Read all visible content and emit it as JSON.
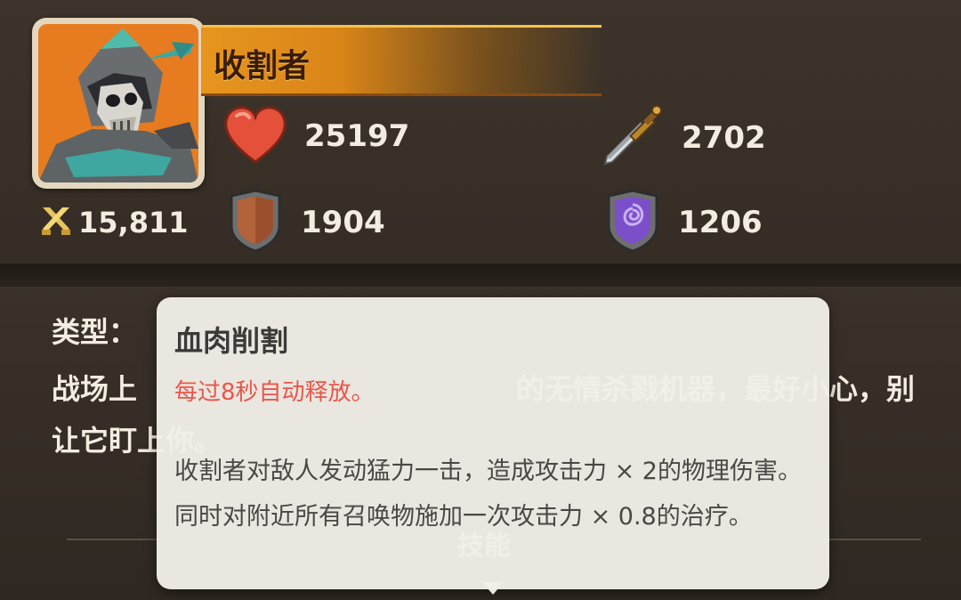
{
  "hero": {
    "name": "收割者",
    "power": "15,811",
    "portrait_icon": "reaper-skull-knight-portrait"
  },
  "stats": {
    "health": {
      "value": "25197",
      "icon": "heart-icon",
      "color": "#e4503a"
    },
    "attack": {
      "value": "2702",
      "icon": "sword-icon",
      "color": "#c9c9c9"
    },
    "armor": {
      "value": "1904",
      "icon": "armor-shield-icon",
      "color": "#a0522d"
    },
    "magic_resist": {
      "value": "1206",
      "icon": "magic-shield-icon",
      "color": "#7b4fc9"
    }
  },
  "description": {
    "type_label": "类型：",
    "body_visible": "战场上",
    "body_right": "的无情杀戮机器，最好小心，别",
    "body_line2": "让它盯上你。"
  },
  "section": {
    "skills_label": "技能"
  },
  "tooltip": {
    "title": "血肉削割",
    "trigger": "每过8秒自动释放。",
    "body": "收割者对敌人发动猛力一击，造成攻击力 × 2的物理伤害。同时对附近所有召唤物施加一次攻击力 × 0.8的治疗。",
    "trigger_color": "#e8574a"
  }
}
